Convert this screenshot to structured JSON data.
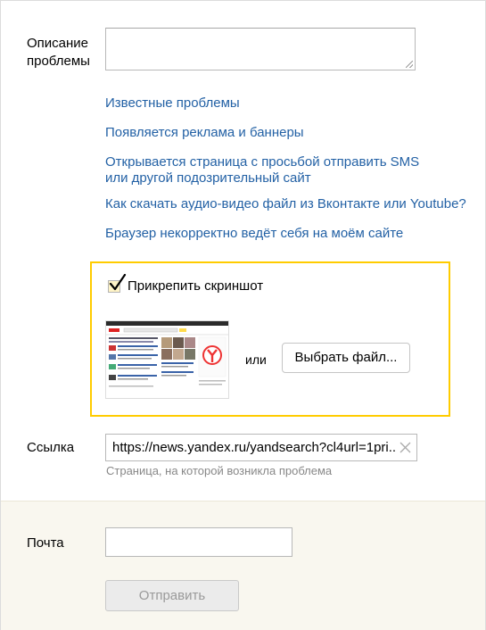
{
  "form": {
    "description_label": "Описание проблемы",
    "description_value": "",
    "link_label": "Ссылка",
    "link_value": "https://news.yandex.ru/yandsearch?cl4url=1pri...",
    "link_hint": "Страница, на которой возникла проблема",
    "email_label": "Почта",
    "email_value": "",
    "submit_label": "Отправить"
  },
  "help_links": [
    "Известные проблемы",
    "Появляется реклама и баннеры",
    "Открывается страница с просьбой отправить SMS или другой подозрительный сайт",
    "Как скачать аудио-видео файл из Вконтакте или Youtube?",
    "Браузер некорректно ведёт себя на моём сайте"
  ],
  "attachment": {
    "checkbox_label": "Прикрепить скриншот",
    "checked": true,
    "or_text": "или",
    "choose_file_label": "Выбрать файл..."
  },
  "colors": {
    "link": "#2361a5",
    "highlight_border": "#ffcc00",
    "footer_bg": "#f9f7ef"
  },
  "icons": {
    "checkbox": "check-mark-icon",
    "clear": "clear-x-icon"
  }
}
